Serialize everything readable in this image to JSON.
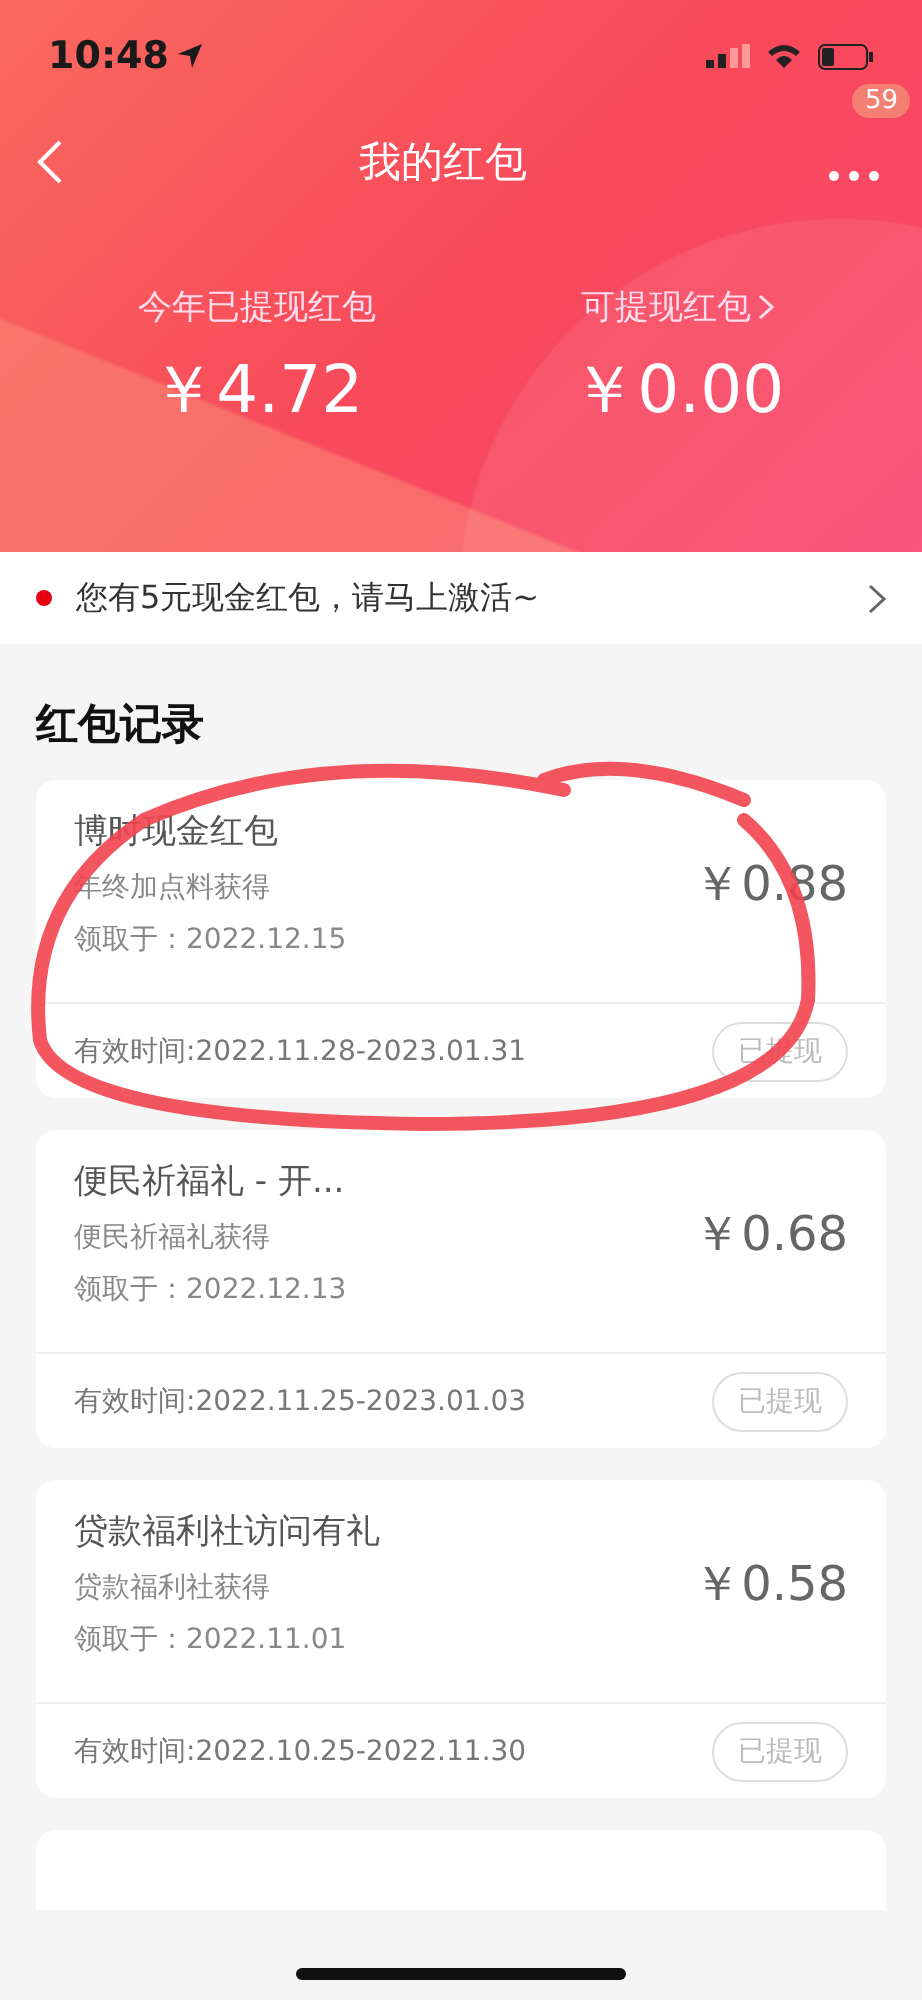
{
  "status_bar": {
    "time": "10:48"
  },
  "nav": {
    "title": "我的红包",
    "badge": "59"
  },
  "summary": [
    {
      "label": "今年已提现红包",
      "amount": "￥4.72",
      "link": false
    },
    {
      "label": "可提现红包",
      "amount": "￥0.00",
      "link": true
    }
  ],
  "notice": {
    "text": "您有5元现金红包，请马上激活~"
  },
  "section_title": "红包记录",
  "records": [
    {
      "title": "博时现金红包",
      "source": "年终加点料获得",
      "received": "领取于：2022.12.15",
      "amount": "￥0.88",
      "validity": "有效时间:2022.11.28-2023.01.31",
      "action": "已提现",
      "circled": true
    },
    {
      "title": "便民祈福礼 - 开...",
      "source": "便民祈福礼获得",
      "received": "领取于：2022.12.13",
      "amount": "￥0.68",
      "validity": "有效时间:2022.11.25-2023.01.03",
      "action": "已提现",
      "circled": false
    },
    {
      "title": "贷款福利社访问有礼",
      "source": "贷款福利社获得",
      "received": "领取于：2022.11.01",
      "amount": "￥0.58",
      "validity": "有效时间:2022.10.25-2022.11.30",
      "action": "已提现",
      "circled": false
    }
  ]
}
